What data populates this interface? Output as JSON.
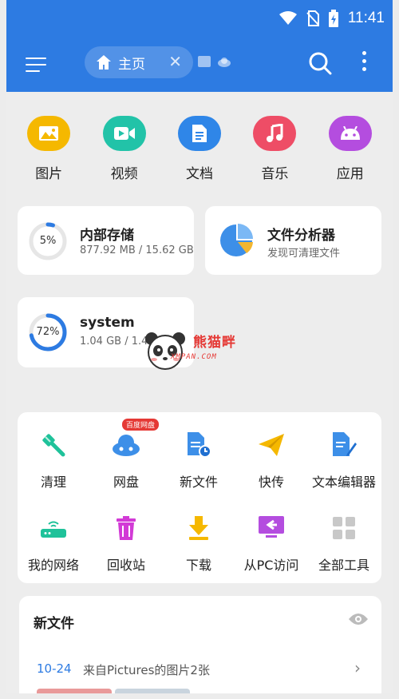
{
  "status_bar": {
    "time": "11:41"
  },
  "app_bar": {
    "home_tab_label": "主页"
  },
  "categories": [
    {
      "label": "图片",
      "icon": "image-icon",
      "color": "#f5b800"
    },
    {
      "label": "视频",
      "icon": "video-icon",
      "color": "#22c3a8"
    },
    {
      "label": "文档",
      "icon": "document-icon",
      "color": "#2f86e8"
    },
    {
      "label": "音乐",
      "icon": "music-icon",
      "color": "#ee4d66"
    },
    {
      "label": "应用",
      "icon": "android-icon",
      "color": "#b44ddf"
    }
  ],
  "storage": {
    "internal": {
      "title": "内部存储",
      "percent_label": "5%",
      "percent": 5,
      "usage": "877.92 MB / 15.62 GB"
    },
    "analyzer": {
      "title": "文件分析器",
      "subtitle": "发现可清理文件"
    },
    "system": {
      "title": "system",
      "percent_label": "72%",
      "percent": 72,
      "usage": "1.04 GB / 1.44 GB"
    }
  },
  "watermark": {
    "name": "熊猫畔",
    "site": "XMPAN.COM"
  },
  "tools": {
    "badge": "百度网盘",
    "items": [
      {
        "label": "清理",
        "icon": "broom-icon"
      },
      {
        "label": "网盘",
        "icon": "cloud-icon"
      },
      {
        "label": "新文件",
        "icon": "new-file-icon"
      },
      {
        "label": "快传",
        "icon": "send-icon"
      },
      {
        "label": "文本编辑器",
        "icon": "text-editor-icon"
      },
      {
        "label": "我的网络",
        "icon": "router-icon"
      },
      {
        "label": "回收站",
        "icon": "trash-icon"
      },
      {
        "label": "下载",
        "icon": "download-icon"
      },
      {
        "label": "从PC访问",
        "icon": "pc-access-icon"
      },
      {
        "label": "全部工具",
        "icon": "grid-icon"
      }
    ]
  },
  "recent": {
    "title": "新文件",
    "date": "10-24",
    "description": "来自Pictures的图片2张"
  }
}
